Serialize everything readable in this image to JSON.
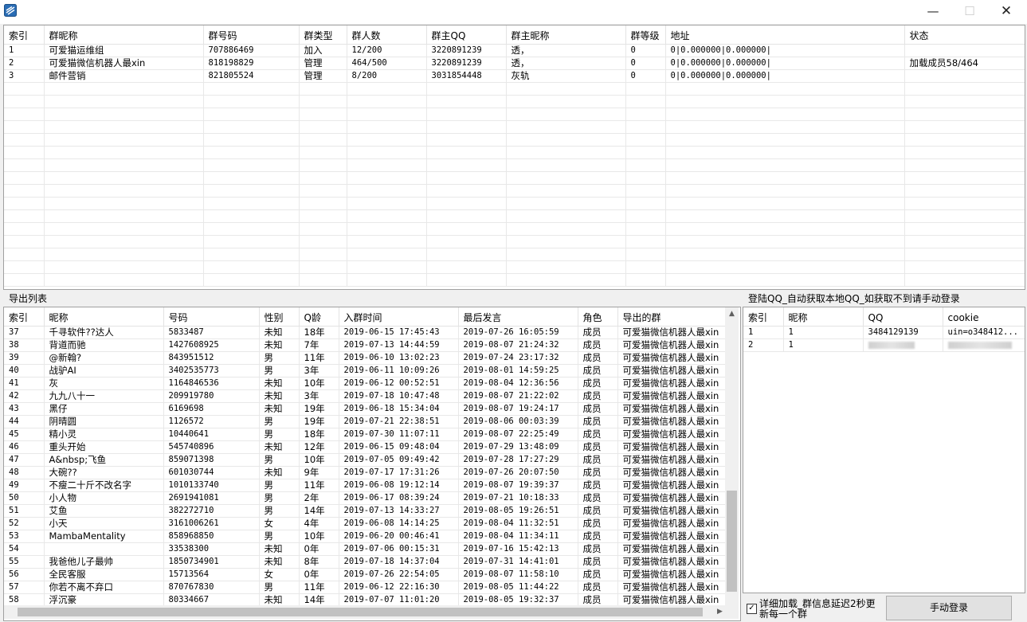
{
  "window": {
    "icon": "app-logo-icon",
    "minimize_glyph": "—",
    "maximize_glyph": "☐",
    "close_glyph": "✕"
  },
  "groups_table": {
    "columns": [
      "索引",
      "群昵称",
      "群号码",
      "群类型",
      "群人数",
      "群主QQ",
      "群主昵称",
      "群等级",
      "地址",
      "状态"
    ],
    "rows": [
      [
        "1",
        "可爱猫运维组",
        "707886469",
        "加入",
        "12/200",
        "3220891239",
        "透，",
        "0",
        "0|0.000000|0.000000|",
        ""
      ],
      [
        "2",
        "可爱猫微信机器人最xin",
        "818198829",
        "管理",
        "464/500",
        "3220891239",
        "透，",
        "0",
        "0|0.000000|0.000000|",
        "加载成员58/464"
      ],
      [
        "3",
        "邮件营销",
        "821805524",
        "管理",
        "8/200",
        "3031854448",
        "灰轨",
        "0",
        "0|0.000000|0.000000|",
        ""
      ]
    ]
  },
  "export_list": {
    "title": "导出列表",
    "columns": [
      "索引",
      "昵称",
      "号码",
      "性别",
      "Q龄",
      "入群时间",
      "最后发言",
      "角色",
      "导出的群"
    ],
    "rows": [
      [
        "37",
        "千寻软件??达人",
        "5833487",
        "未知",
        "18年",
        "2019-06-15 17:45:43",
        "2019-07-26 16:05:59",
        "成员",
        "可爱猫微信机器人最xin"
      ],
      [
        "38",
        "背道而驰",
        "1427608925",
        "未知",
        "7年",
        "2019-07-13 14:44:59",
        "2019-08-07 21:24:32",
        "成员",
        "可爱猫微信机器人最xin"
      ],
      [
        "39",
        "@新翰?",
        "843951512",
        "男",
        "11年",
        "2019-06-10 13:02:23",
        "2019-07-24 23:17:32",
        "成员",
        "可爱猫微信机器人最xin"
      ],
      [
        "40",
        "战驴AI",
        "3402535773",
        "男",
        "3年",
        "2019-06-11 10:09:26",
        "2019-08-01 14:59:25",
        "成员",
        "可爱猫微信机器人最xin"
      ],
      [
        "41",
        "灰",
        "1164846536",
        "未知",
        "10年",
        "2019-06-12 00:52:51",
        "2019-08-04 12:36:56",
        "成员",
        "可爱猫微信机器人最xin"
      ],
      [
        "42",
        "九九八十一",
        "209919780",
        "未知",
        "3年",
        "2019-07-18 10:47:48",
        "2019-08-07 21:22:02",
        "成员",
        "可爱猫微信机器人最xin"
      ],
      [
        "43",
        "黑仔",
        "6169698",
        "未知",
        "19年",
        "2019-06-18 15:34:04",
        "2019-08-07 19:24:17",
        "成员",
        "可爱猫微信机器人最xin"
      ],
      [
        "44",
        "阴晴圆",
        "1126572",
        "男",
        "19年",
        "2019-07-21 22:38:51",
        "2019-08-06 00:03:39",
        "成员",
        "可爱猫微信机器人最xin"
      ],
      [
        "45",
        "精小灵",
        "10440641",
        "男",
        "18年",
        "2019-07-30 11:07:11",
        "2019-08-07 22:25:49",
        "成员",
        "可爱猫微信机器人最xin"
      ],
      [
        "46",
        "重头开始",
        "545740896",
        "未知",
        "12年",
        "2019-06-15 09:48:04",
        "2019-07-29 13:48:09",
        "成员",
        "可爱猫微信机器人最xin"
      ],
      [
        "47",
        "A&nbsp;飞鱼",
        "859071398",
        "男",
        "10年",
        "2019-07-05 09:49:42",
        "2019-07-28 17:27:29",
        "成员",
        "可爱猫微信机器人最xin"
      ],
      [
        "48",
        "大碗??",
        "601030744",
        "未知",
        "9年",
        "2019-07-17 17:31:26",
        "2019-07-26 20:07:50",
        "成员",
        "可爱猫微信机器人最xin"
      ],
      [
        "49",
        "不瘦二十斤不改名字",
        "1010133740",
        "男",
        "11年",
        "2019-06-08 19:12:14",
        "2019-08-07 19:39:37",
        "成员",
        "可爱猫微信机器人最xin"
      ],
      [
        "50",
        "小人物",
        "2691941081",
        "男",
        "2年",
        "2019-06-17 08:39:24",
        "2019-07-21 10:18:33",
        "成员",
        "可爱猫微信机器人最xin"
      ],
      [
        "51",
        "艾鱼",
        "382272710",
        "男",
        "14年",
        "2019-07-13 14:33:27",
        "2019-08-05 19:26:51",
        "成员",
        "可爱猫微信机器人最xin"
      ],
      [
        "52",
        "小天",
        "3161006261",
        "女",
        "4年",
        "2019-06-08 14:14:25",
        "2019-08-04 11:32:51",
        "成员",
        "可爱猫微信机器人最xin"
      ],
      [
        "53",
        "MambaMentality",
        "858968850",
        "男",
        "10年",
        "2019-06-20 00:46:41",
        "2019-08-04 11:34:11",
        "成员",
        "可爱猫微信机器人最xin"
      ],
      [
        "54",
        "",
        "33538300",
        "未知",
        "0年",
        "2019-07-06 00:15:31",
        "2019-07-16 15:42:13",
        "成员",
        "可爱猫微信机器人最xin"
      ],
      [
        "55",
        "我爸他儿子最帅",
        "1850734901",
        "未知",
        "8年",
        "2019-07-18 14:37:04",
        "2019-07-31 14:41:01",
        "成员",
        "可爱猫微信机器人最xin"
      ],
      [
        "56",
        "全民客服",
        "15713564",
        "女",
        "0年",
        "2019-07-26 22:54:05",
        "2019-08-07 11:58:10",
        "成员",
        "可爱猫微信机器人最xin"
      ],
      [
        "57",
        "你若不离不弃口",
        "870767830",
        "男",
        "11年",
        "2019-06-12 22:16:30",
        "2019-08-05 11:44:22",
        "成员",
        "可爱猫微信机器人最xin"
      ],
      [
        "58",
        "浮沉豪",
        "80334667",
        "未知",
        "14年",
        "2019-07-07 11:01:20",
        "2019-08-05 19:32:37",
        "成员",
        "可爱猫微信机器人最xin"
      ]
    ]
  },
  "login_panel": {
    "title": "登陆QQ_自动获取本地QQ_如获取不到请手动登录",
    "columns": [
      "索引",
      "昵称",
      "QQ",
      "cookie"
    ],
    "rows": [
      [
        "1",
        "1",
        "3484129139",
        "uin=o348412..."
      ],
      [
        "2",
        "1",
        "",
        ""
      ]
    ]
  },
  "options": {
    "detail_load_label": "详细加载_群信息延迟2秒更新每一个群",
    "detail_load_checked": true,
    "manual_login_label": "手动登录"
  }
}
